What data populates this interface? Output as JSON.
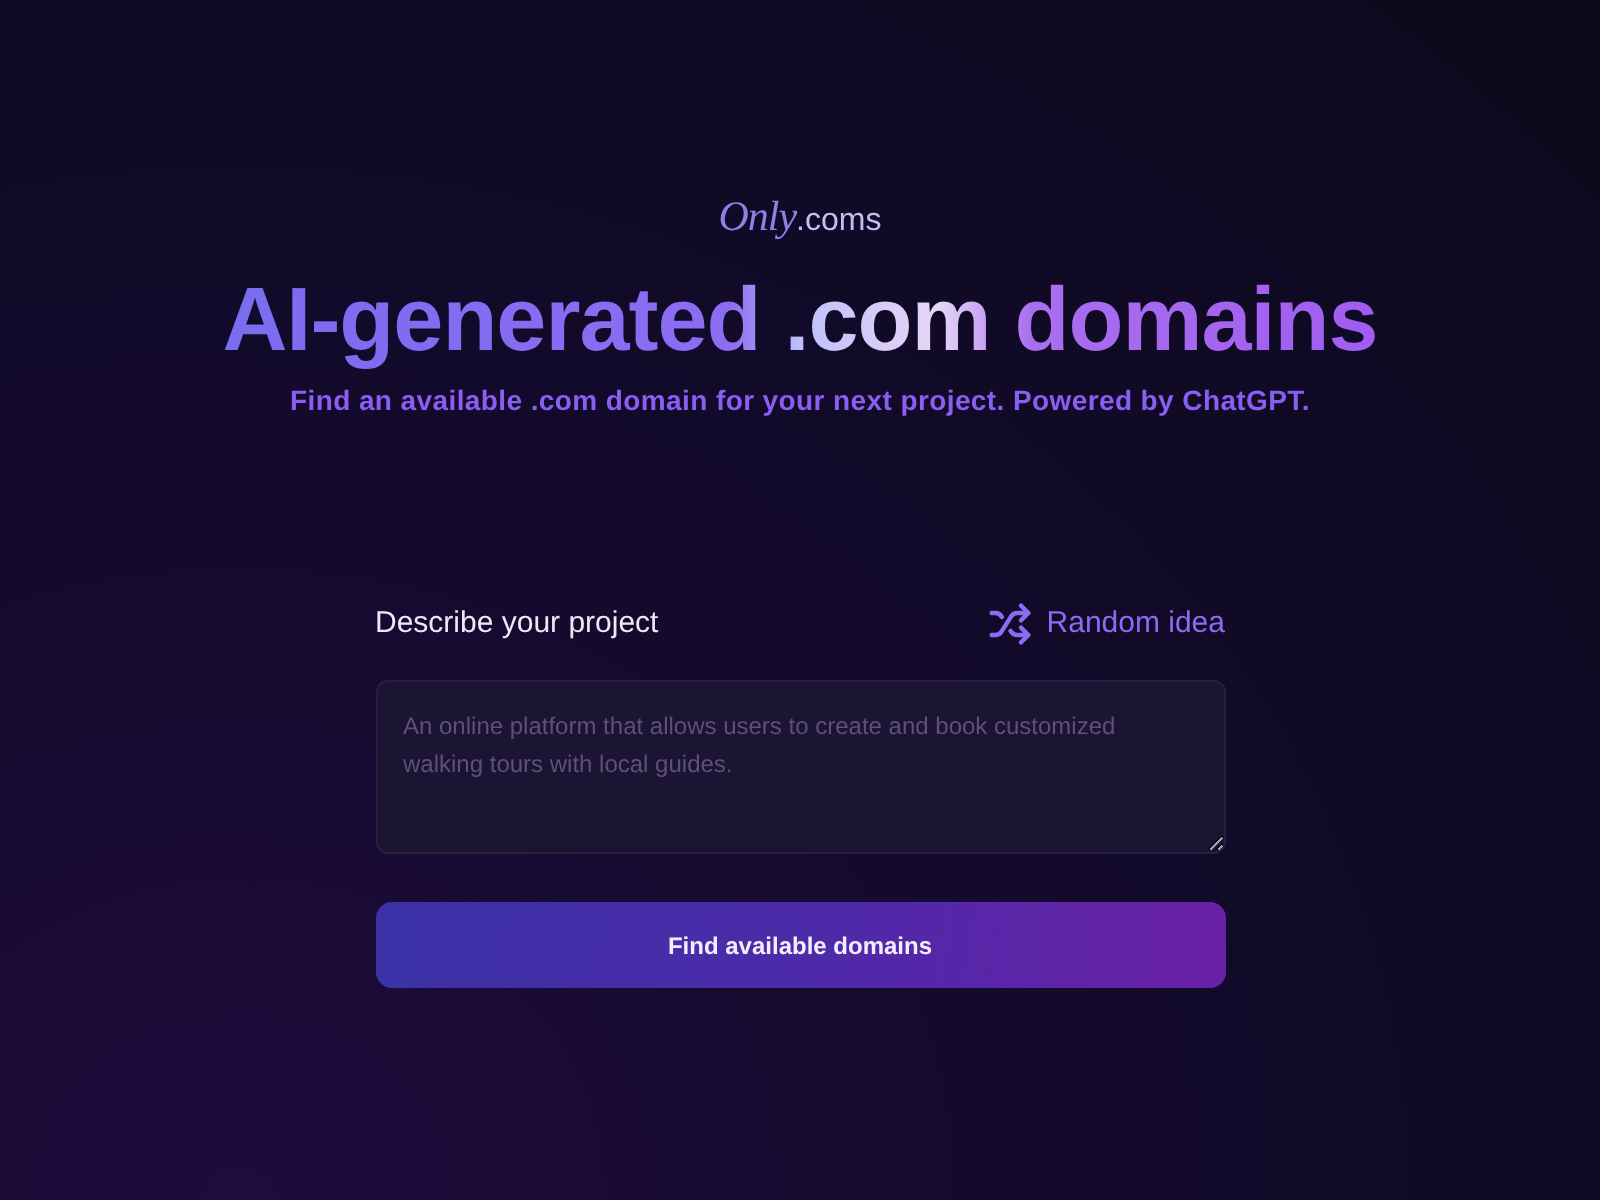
{
  "logo": {
    "script": "Only",
    "suffix": ".coms"
  },
  "headline": "AI-generated .com domains",
  "subtitle": "Find an available .com domain for your next project. Powered by ChatGPT.",
  "form": {
    "label": "Describe your project",
    "random_button": "Random idea",
    "textarea": {
      "placeholder": "An online platform that allows users to create and book customized walking tours with local guides."
    },
    "submit_button": "Find available domains"
  }
}
